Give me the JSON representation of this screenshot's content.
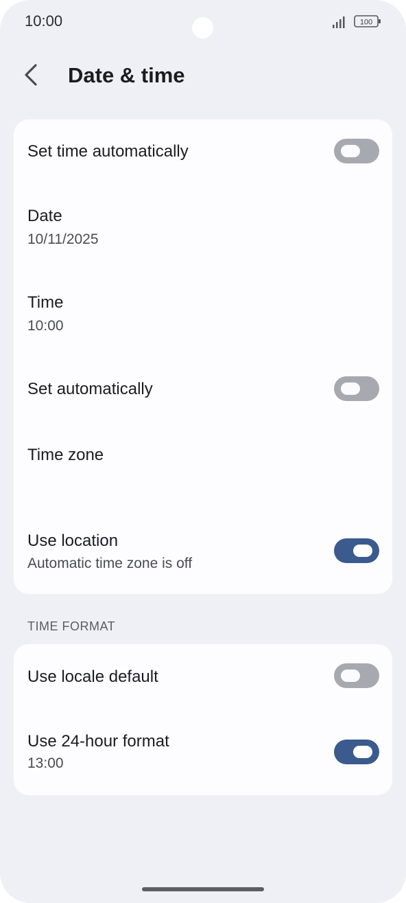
{
  "status_bar": {
    "time": "10:00",
    "battery_level": "100",
    "icons": [
      "signal-icon",
      "battery-icon"
    ]
  },
  "app_bar": {
    "back_icon": "back-arrow-icon",
    "title": "Date & time"
  },
  "settings": {
    "set_time_automatically": {
      "title": "Set time automatically",
      "enabled": false
    },
    "date": {
      "title": "Date",
      "value": "10/11/2025"
    },
    "time": {
      "title": "Time",
      "value": "10:00"
    },
    "set_automatically": {
      "title": "Set automatically",
      "enabled": false
    },
    "time_zone": {
      "title": "Time zone"
    },
    "use_location": {
      "title": "Use location",
      "subtitle": "Automatic time zone is off",
      "enabled": true
    }
  },
  "time_format": {
    "header": "TIME FORMAT",
    "use_locale_default": {
      "title": "Use locale default",
      "enabled": false
    },
    "use_24_hour": {
      "title": "Use 24-hour format",
      "subtitle": "13:00",
      "enabled": true
    }
  },
  "colors": {
    "background": "#eff0f5",
    "card": "#fdfdff",
    "toggle_on": "#3b5a8d",
    "toggle_off": "#a7a9b0"
  }
}
